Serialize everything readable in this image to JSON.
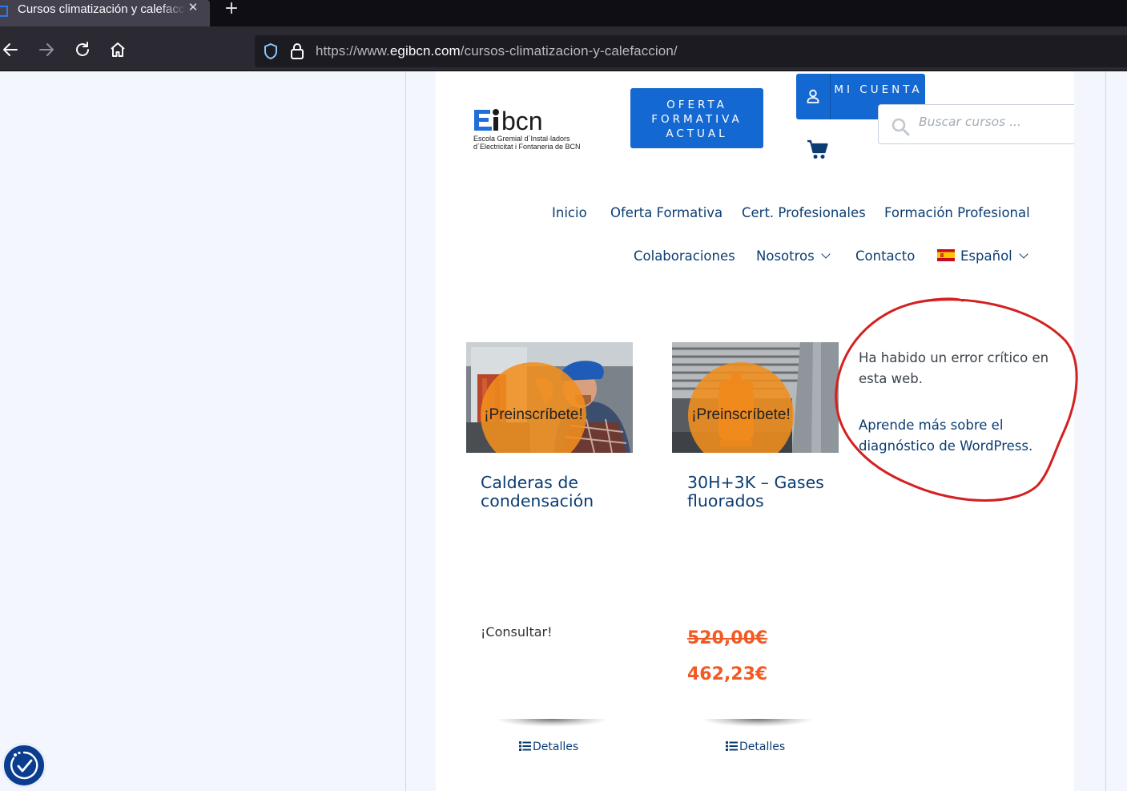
{
  "browser": {
    "tab_title": "Cursos climatización y calefacción",
    "tab_close": "✕",
    "new_tab": "+",
    "url_prefix": "https://www.",
    "url_host": "egibcn.com",
    "url_path": "/cursos-climatizacion-y-calefaccion/"
  },
  "header": {
    "logo_word": "bcn",
    "logo_tagline_1": "Escola Gremial d´Instal·ladors",
    "logo_tagline_2": "d´Electricitat i Fontaneria de BCN",
    "oferta_button": "OFERTA FORMATIVA ACTUAL",
    "cuenta_button": "MI CUENTA",
    "search_placeholder": "Buscar cursos ..."
  },
  "nav": {
    "row1": [
      "Inicio",
      "Oferta Formativa",
      "Cert. Profesionales",
      "Formación Profesional"
    ],
    "row2": [
      "Colaboraciones",
      "Nosotros",
      "Contacto",
      "Español"
    ]
  },
  "products": [
    {
      "badge": "¡Preinscríbete!",
      "title": "Calderas de condensación",
      "price_label": "¡Consultar!",
      "details": "Detalles"
    },
    {
      "badge": "¡Preinscríbete!",
      "title": "30H+3K – Gases fluorados",
      "price_old": "520,00€",
      "price_new": "462,23€",
      "details": "Detalles"
    }
  ],
  "error": {
    "message": "Ha habido un error crítico en esta web.",
    "link": "Aprende más sobre el diagnóstico de WordPress."
  },
  "colors": {
    "brand_blue": "#1468d1",
    "nav_text": "#0b3d73",
    "price_orange": "#f15a24",
    "badge_orange": "#f18e1e",
    "annotation_red": "#d42020"
  }
}
